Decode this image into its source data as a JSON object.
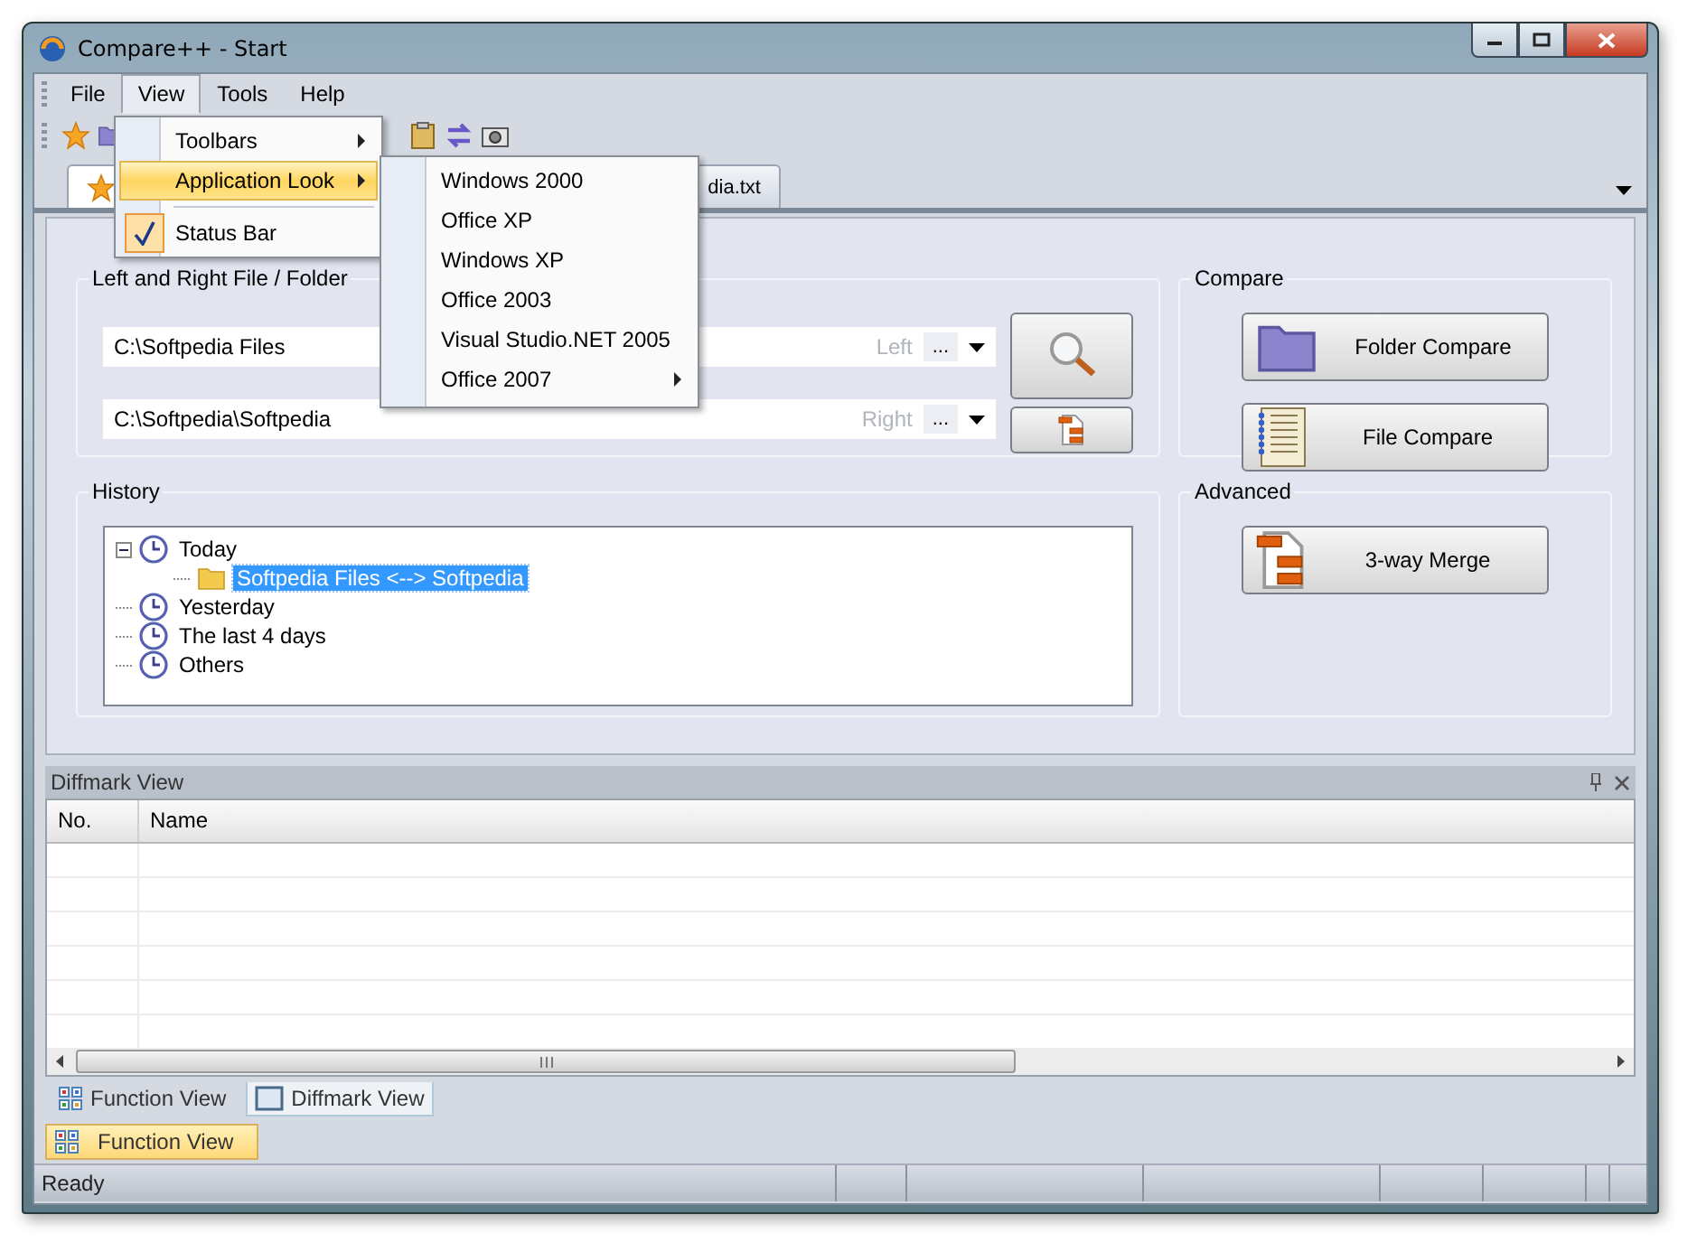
{
  "window": {
    "title": "Compare++ - Start"
  },
  "menu_bar": [
    {
      "label": "File",
      "selected": false
    },
    {
      "label": "View",
      "selected": true
    },
    {
      "label": "Tools",
      "selected": false
    },
    {
      "label": "Help",
      "selected": false
    }
  ],
  "view_menu": [
    {
      "kind": "submenu",
      "label": "Toolbars",
      "highlighted": false,
      "checked": false
    },
    {
      "kind": "submenu",
      "label": "Application Look",
      "highlighted": true,
      "checked": false
    },
    {
      "kind": "separator"
    },
    {
      "kind": "item",
      "label": "Status Bar",
      "highlighted": false,
      "checked": true
    }
  ],
  "look_submenu": [
    {
      "label": "Windows 2000",
      "has_submenu": false
    },
    {
      "label": "Office XP",
      "has_submenu": false
    },
    {
      "label": "Windows XP",
      "has_submenu": false
    },
    {
      "label": "Office 2003",
      "has_submenu": false
    },
    {
      "label": "Visual Studio.NET 2005",
      "has_submenu": false
    },
    {
      "label": "Office 2007",
      "has_submenu": true
    }
  ],
  "document_tabs": [
    {
      "kind": "start",
      "selected": true
    },
    {
      "kind": "file",
      "label": "dia.txt",
      "selected": false
    }
  ],
  "file_group": {
    "title": "Left and Right File / Folder",
    "rows": [
      {
        "value": "C:\\Softpedia Files",
        "side_label": "Left",
        "browse": "..."
      },
      {
        "value": "C:\\Softpedia\\Softpedia",
        "side_label": "Right",
        "browse": "..."
      }
    ]
  },
  "history": {
    "title": "History",
    "tree": [
      {
        "kind": "period",
        "label": "Today",
        "selected": false,
        "children": [
          {
            "kind": "comparison",
            "label": "Softpedia Files <--> Softpedia",
            "selected": true
          }
        ]
      },
      {
        "kind": "period",
        "label": "Yesterday",
        "selected": false
      },
      {
        "kind": "period",
        "label": "The last 4 days",
        "selected": false
      },
      {
        "kind": "period",
        "label": "Others",
        "selected": false
      }
    ]
  },
  "compare": {
    "title": "Compare",
    "buttons": [
      {
        "kind": "folder",
        "label": "Folder Compare"
      },
      {
        "kind": "file",
        "label": "File Compare"
      }
    ]
  },
  "advanced": {
    "title": "Advanced",
    "buttons": [
      {
        "kind": "merge",
        "label": "3-way Merge"
      }
    ]
  },
  "diffmark": {
    "title": "Diffmark View",
    "columns": [
      "No.",
      "Name"
    ]
  },
  "bottom_tabs": [
    {
      "kind": "function",
      "label": "Function View",
      "selected": false
    },
    {
      "kind": "diffmark",
      "label": "Diffmark View",
      "selected": true
    }
  ],
  "autohide_tab": {
    "label": "Function View"
  },
  "status_bar": {
    "text": "Ready"
  }
}
